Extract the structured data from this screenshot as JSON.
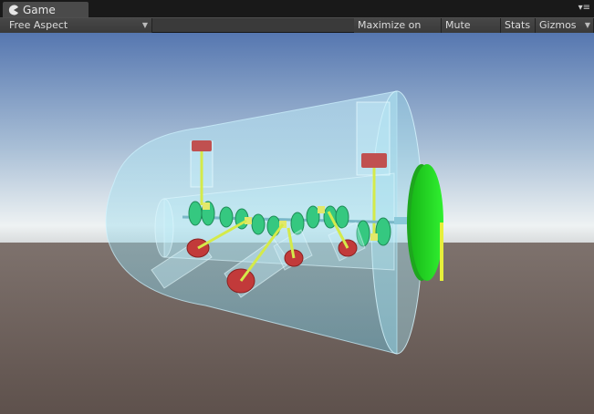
{
  "tab": {
    "label": "Game",
    "icon": "pacman-icon"
  },
  "tab_menu_icon": "menu-icon",
  "toolbar": {
    "aspect_label": "Free Aspect",
    "maximize_label": "Maximize on Play",
    "mute_label": "Mute audio",
    "stats_label": "Stats",
    "gizmos_label": "Gizmos"
  },
  "scene": {
    "sky_top": "#5a7fb8",
    "horizon": "#e6ecef",
    "ground": "#6a5c55",
    "cylinder_tint": "#a8e4f0",
    "flywheel": "#22e622",
    "rod": "#d2e84a",
    "piston": "#c23a3a",
    "gear": "#35c880"
  }
}
